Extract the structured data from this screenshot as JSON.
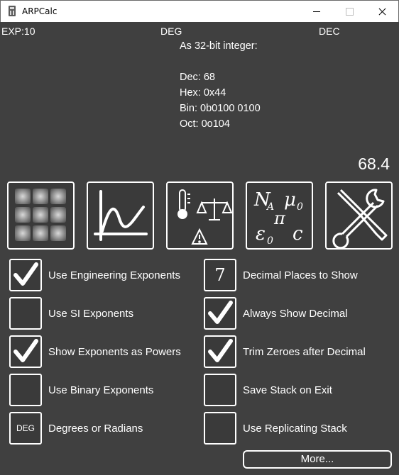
{
  "window": {
    "title": "ARPCalc"
  },
  "status": {
    "exponent": "EXP:10",
    "angle_mode": "DEG",
    "base_mode": "DEC"
  },
  "integer_info": {
    "heading": "As 32-bit integer:",
    "dec": "Dec: 68",
    "hex": "Hex: 0x44",
    "bin": "Bin: 0b0100 0100",
    "oct": "Oct: 0o104"
  },
  "display_value": "68.4",
  "function_buttons": [
    {
      "name": "keypad",
      "icon": "keypad-grid-icon"
    },
    {
      "name": "graph",
      "icon": "graph-plot-icon"
    },
    {
      "name": "units",
      "icon": "units-conversion-icon"
    },
    {
      "name": "constants",
      "icon": "physical-constants-icon",
      "glyphs": [
        "N",
        "A",
        "μ",
        "0",
        "π",
        "ε",
        "0",
        "c"
      ]
    },
    {
      "name": "settings",
      "icon": "tools-icon"
    }
  ],
  "settings": {
    "left": [
      {
        "label": "Use Engineering Exponents",
        "checked": true
      },
      {
        "label": "Use SI Exponents",
        "checked": false
      },
      {
        "label": "Show Exponents as Powers",
        "checked": true
      },
      {
        "label": "Use Binary Exponents",
        "checked": false
      },
      {
        "label": "Degrees or Radians",
        "value": "DEG"
      }
    ],
    "right": [
      {
        "label": "Decimal Places to Show",
        "value": "7"
      },
      {
        "label": "Always Show Decimal",
        "checked": true
      },
      {
        "label": "Trim Zeroes after Decimal",
        "checked": true
      },
      {
        "label": "Save Stack on Exit",
        "checked": false
      },
      {
        "label": "Use Replicating Stack",
        "checked": false
      }
    ]
  },
  "more_button": "More...",
  "colors": {
    "background": "#404040",
    "foreground": "#ffffff",
    "titlebar": "#ffffff"
  }
}
